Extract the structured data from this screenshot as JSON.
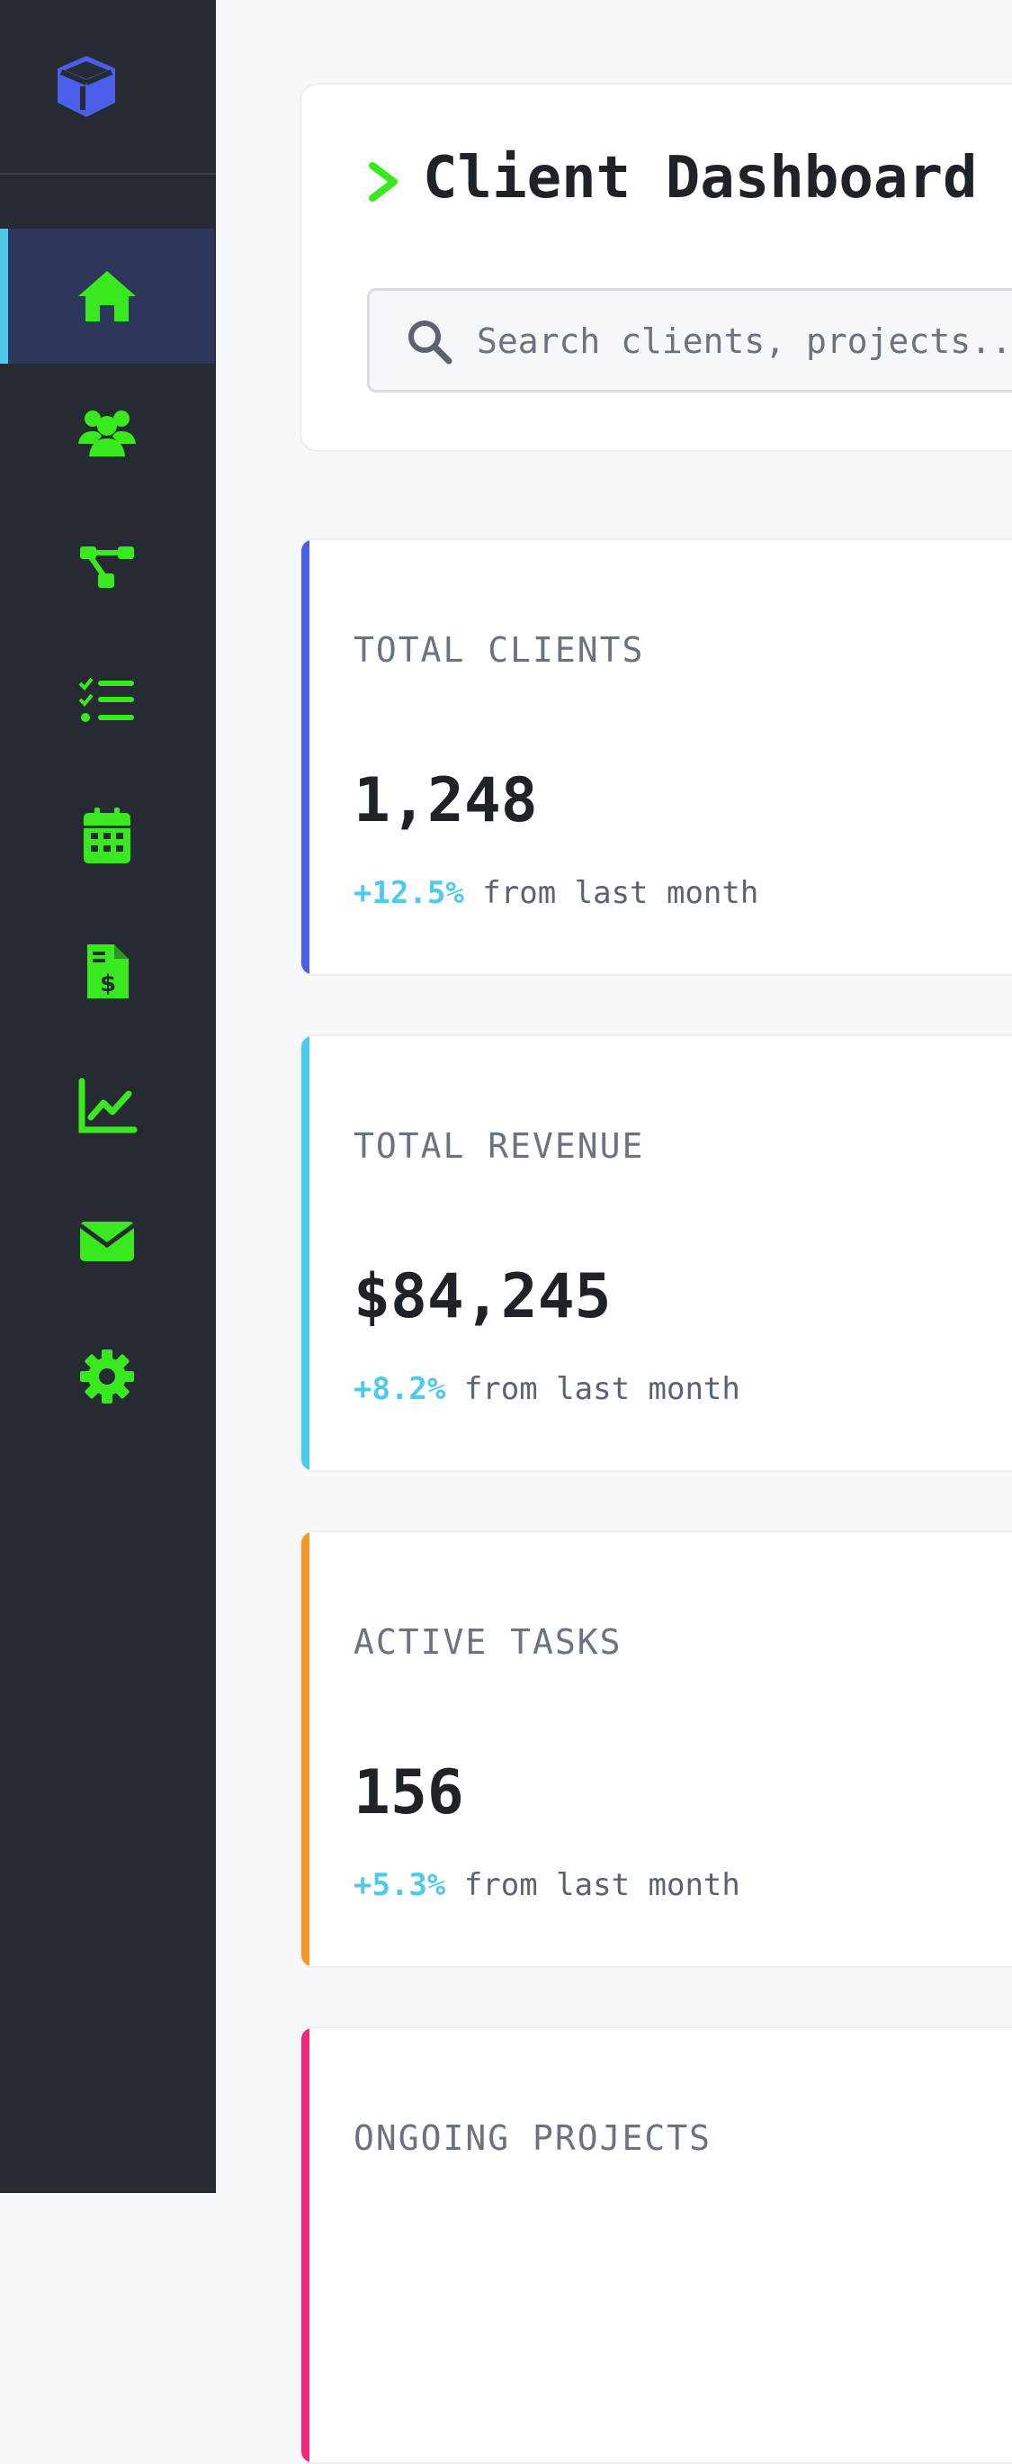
{
  "colors": {
    "sidebar_bg": "#262b33",
    "active_bg": "#2f365c",
    "active_indicator": "#4fc9ec",
    "icon_green": "#39e81f",
    "logo_blue": "#4a5ee8",
    "positive_change": "#4fc9ec"
  },
  "sidebar": {
    "logo_icon": "cube-icon",
    "items": [
      {
        "id": "home",
        "icon": "home-icon",
        "active": true
      },
      {
        "id": "clients",
        "icon": "users-icon",
        "active": false
      },
      {
        "id": "projects",
        "icon": "sitemap-icon",
        "active": false
      },
      {
        "id": "tasks",
        "icon": "tasks-list-icon",
        "active": false
      },
      {
        "id": "calendar",
        "icon": "calendar-icon",
        "active": false
      },
      {
        "id": "invoices",
        "icon": "invoice-dollar-icon",
        "active": false
      },
      {
        "id": "analytics",
        "icon": "chart-line-icon",
        "active": false
      },
      {
        "id": "messages",
        "icon": "envelope-icon",
        "active": false
      },
      {
        "id": "settings",
        "icon": "gear-icon",
        "active": false
      }
    ]
  },
  "header": {
    "prompt_icon": "chevron-right-icon",
    "title": "Client Dashboard",
    "search": {
      "icon": "search-icon",
      "placeholder": "Search clients, projects...",
      "value": ""
    }
  },
  "stats": [
    {
      "label": "TOTAL CLIENTS",
      "value": "1,248",
      "change": "+12.5%",
      "change_suffix": " from last month",
      "accent": "#4a5ee8"
    },
    {
      "label": "TOTAL REVENUE",
      "value": "$84,245",
      "change": "+8.2%",
      "change_suffix": " from last month",
      "accent": "#4fc9ec"
    },
    {
      "label": "ACTIVE TASKS",
      "value": "156",
      "change": "+5.3%",
      "change_suffix": " from last month",
      "accent": "#f39a26"
    },
    {
      "label": "ONGOING PROJECTS",
      "value": "",
      "change": "",
      "change_suffix": "",
      "accent": "#f0277e"
    }
  ]
}
